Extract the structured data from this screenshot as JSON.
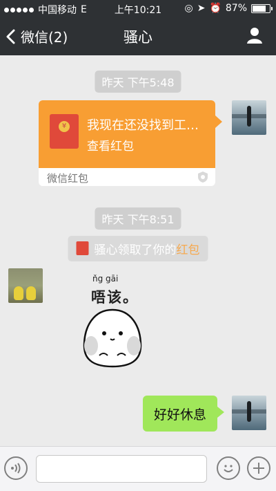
{
  "status_bar": {
    "carrier": "中国移动",
    "network": "E",
    "time": "上午10:21",
    "battery": "87%",
    "battery_level": 0.87
  },
  "nav": {
    "back_label": "微信(2)",
    "title": "骚心"
  },
  "messages": {
    "timestamp_1": "昨天 下午5:48",
    "red_packet": {
      "message": "我现在还没找到工…",
      "action": "查看红包",
      "footer": "微信红包"
    },
    "timestamp_2": "昨天 下午8:51",
    "notice": {
      "prefix": "骚心领取了你的",
      "highlight": "红包"
    },
    "sticker": {
      "pinyin": "ňg gāi",
      "text": "唔该。"
    },
    "green_bubble": "好好休息"
  },
  "colors": {
    "nav_bg": "#2e3134",
    "chat_bg": "#ebebeb",
    "red_packet": "#f89e33",
    "green_bubble": "#a0e75a",
    "highlight": "#f6a94f"
  },
  "icons": {
    "back": "chevron-left-icon",
    "profile": "person-icon",
    "voice": "voice-icon",
    "emoji": "emoji-icon",
    "plus": "plus-icon"
  }
}
